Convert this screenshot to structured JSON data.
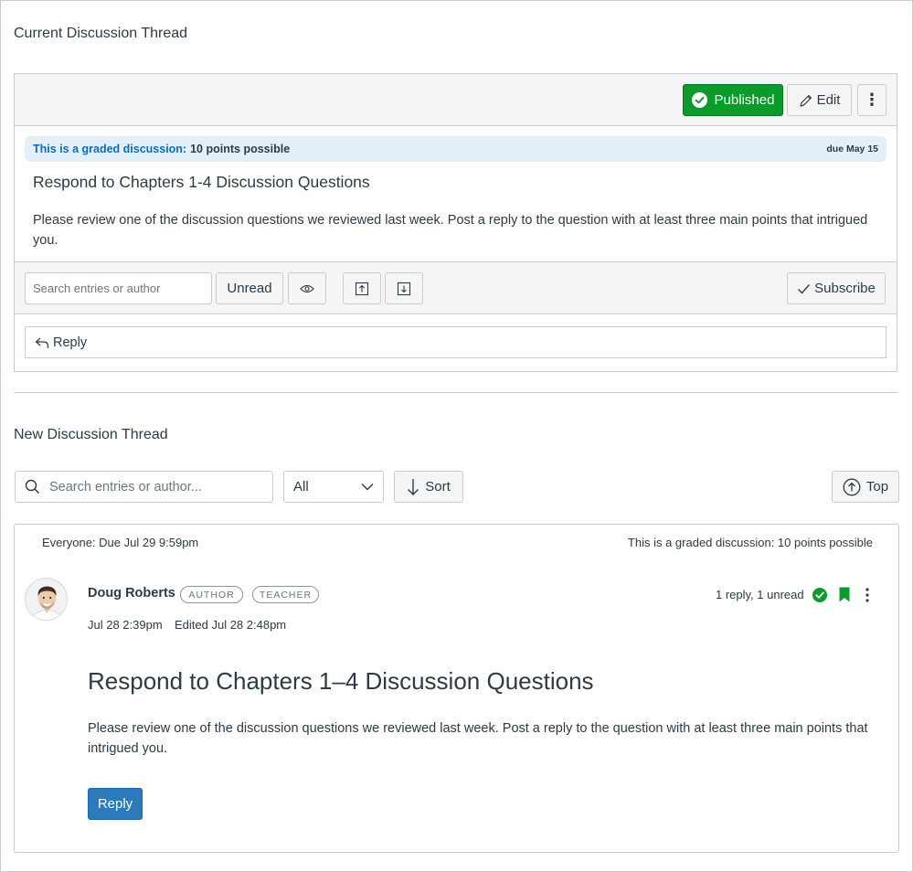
{
  "current_thread": {
    "section_title": "Current Discussion Thread",
    "published_label": "Published",
    "edit_label": "Edit",
    "more_label": "⋮",
    "graded_label": "This is a graded discussion:",
    "points_label": "10 points possible",
    "due_label": "due May 15",
    "title": "Respond to Chapters 1-4 Discussion Questions",
    "body": "Please review one of the discussion questions we reviewed last week. Post a reply to the question with at least three main points that intrigued you.",
    "search_placeholder": "Search entries or author",
    "unread_label": "Unread",
    "subscribe_label": "Subscribe",
    "reply_label": "Reply"
  },
  "new_thread": {
    "section_title": "New Discussion Thread",
    "search_placeholder": "Search entries or author...",
    "filter_value": "All",
    "sort_label": "Sort",
    "top_label": "Top",
    "entry": {
      "due_text": "Everyone: Due Jul 29 9:59pm",
      "graded_text": "This is a graded discussion: 10 points possible",
      "author_name": "Doug Roberts",
      "badge_author": "AUTHOR",
      "badge_teacher": "TEACHER",
      "reply_count": "1 reply, 1 unread",
      "posted_date": "Jul 28 2:39pm",
      "edited_date": "Edited Jul 28 2:48pm",
      "title": "Respond to Chapters 1–4 Discussion Questions",
      "body": "Please review one of the discussion questions we reviewed last week. Post a reply to the question with at least three main points that intrigued you.",
      "reply_label": "Reply"
    }
  },
  "colors": {
    "published_green": "#0b9b2a",
    "link_blue": "#0e6bb6",
    "graded_bg": "#e3eff9",
    "primary_blue": "#2b7abc",
    "text": "#2d3b45",
    "border": "#c7cdd1",
    "toolbar_bg": "#f5f5f5"
  },
  "icons": {
    "published": "check-circle-icon",
    "edit": "pencil-icon",
    "eye": "eye-icon",
    "expand": "expand-icon",
    "collapse": "collapse-icon",
    "subscribe": "checkmark-icon",
    "reply": "reply-arrow-icon",
    "search": "search-icon",
    "chevron": "chevron-down-icon",
    "sort": "arrow-down-icon",
    "top": "arrow-up-circle-icon",
    "read_status": "check-circle-icon",
    "bookmark": "bookmark-icon",
    "more": "kebab-icon"
  }
}
